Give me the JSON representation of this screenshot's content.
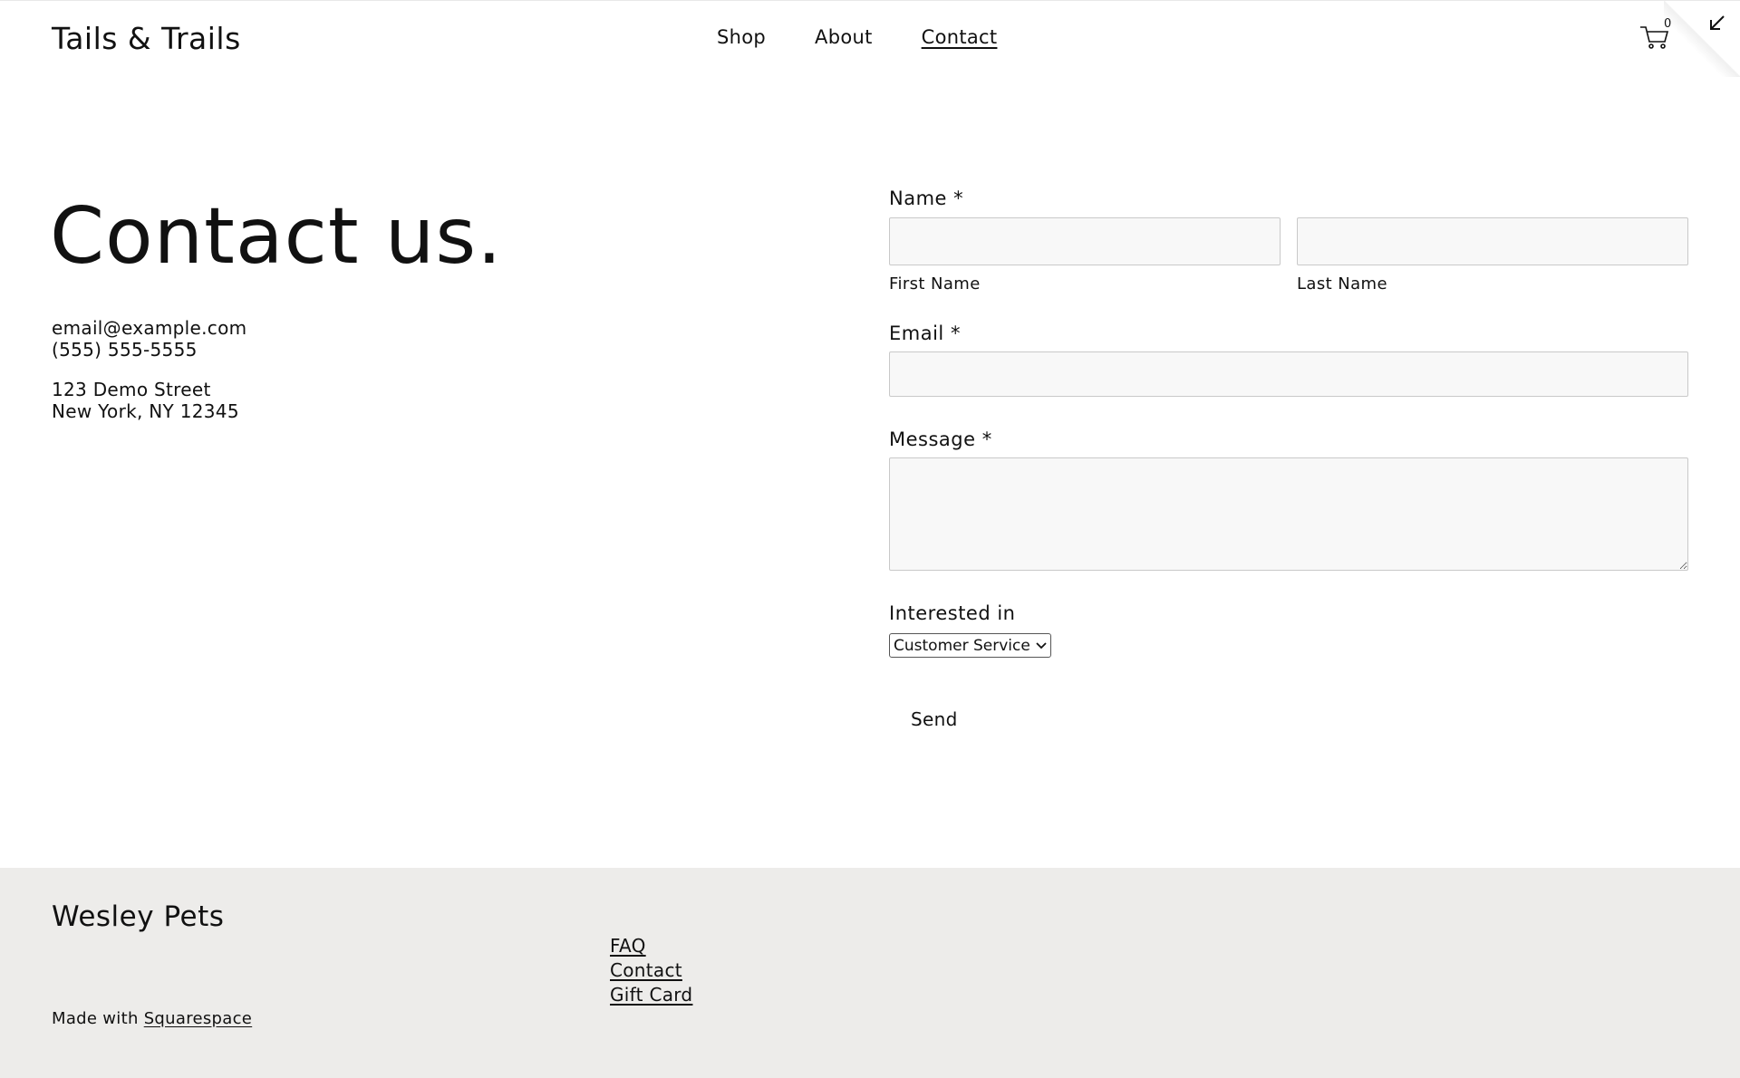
{
  "header": {
    "brand": "Tails & Trails",
    "nav": [
      {
        "label": "Shop"
      },
      {
        "label": "About"
      },
      {
        "label": "Contact",
        "active": true
      }
    ],
    "cart_count": "0",
    "cart_icon": "cart-icon",
    "corner_icon": "arrow-down-left-icon"
  },
  "hero": {
    "title": "Contact us.",
    "email": "email@example.com",
    "phone": "(555) 555-5555",
    "address_line1": "123 Demo Street",
    "address_line2": "New York, NY 12345"
  },
  "form": {
    "name_label": "Name *",
    "first_name_sublabel": "First Name",
    "last_name_sublabel": "Last Name",
    "email_label": "Email *",
    "message_label": "Message *",
    "interested_label": "Interested in",
    "interested_selected": "Customer Service",
    "send_label": "Send"
  },
  "footer": {
    "brand": "Wesley Pets",
    "links": [
      "FAQ",
      "Contact",
      "Gift Card"
    ],
    "made_with_prefix": "Made with",
    "made_with_link": "Squarespace"
  },
  "colors": {
    "text": "#111111",
    "footer_bg": "#edecea",
    "field_bg": "#f8f8f8",
    "field_border": "#c9c9c9"
  }
}
